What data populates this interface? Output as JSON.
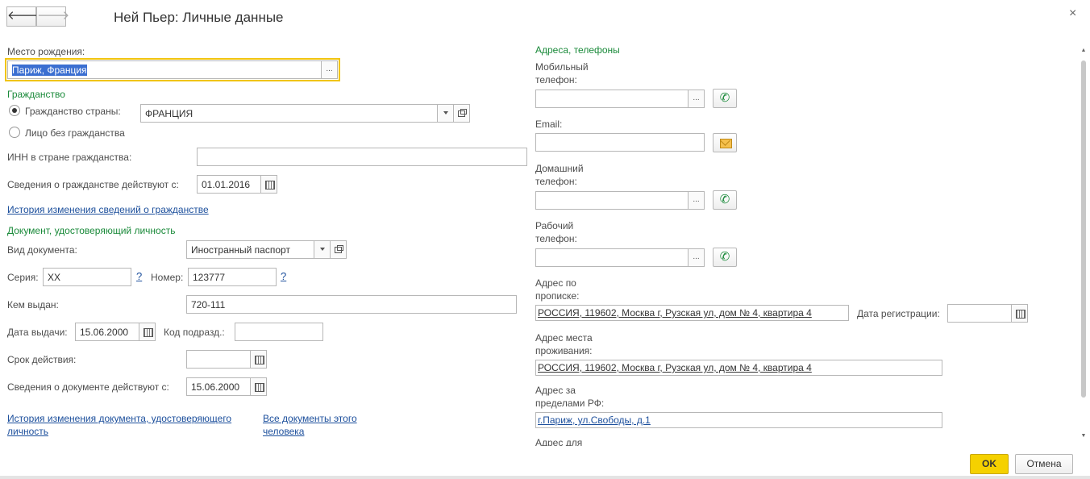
{
  "window": {
    "title": "Ней Пьер: Личные данные",
    "back_label": "🡐",
    "forward_label": "🡒",
    "close_label": "×"
  },
  "left": {
    "birthplace": {
      "label": "Место рождения:",
      "value": "Париж, Франция",
      "button": "..."
    },
    "citizenship": {
      "section": "Гражданство",
      "country_radio_label": "Гражданство страны:",
      "country_value": "ФРАНЦИЯ",
      "stateless_radio_label": "Лицо без гражданства",
      "inn_label": "ИНН в стране гражданства:",
      "inn_value": "",
      "valid_from_label": "Сведения о гражданстве действуют с:",
      "valid_from_value": "01.01.2016",
      "history_link": "История изменения сведений о гражданстве"
    },
    "document": {
      "section": "Документ, удостоверяющий личность",
      "type_label": "Вид документа:",
      "type_value": "Иностранный паспорт",
      "series_label": "Серия:",
      "series_value": "XX",
      "help_mark": "?",
      "number_label": "Номер:",
      "number_value": "123777",
      "issued_by_label": "Кем выдан:",
      "issued_by_value": "720-111",
      "issue_date_label": "Дата выдачи:",
      "issue_date_value": "15.06.2000",
      "division_code_label": "Код подразд.:",
      "division_code_value": "",
      "expiry_label": "Срок действия:",
      "expiry_value": "  .  .",
      "valid_from_label": "Сведения о документе действуют с:",
      "valid_from_value": "15.06.2000",
      "history_link": "История изменения документа, удостоверяющего личность",
      "all_docs_link": "Все документы этого человека"
    }
  },
  "right": {
    "section": "Адреса, телефоны",
    "mobile": {
      "label": "Мобильный телефон:",
      "value": "",
      "button": "..."
    },
    "email": {
      "label": "Email:",
      "value": ""
    },
    "home": {
      "label": "Домашний телефон:",
      "value": "",
      "button": "..."
    },
    "work": {
      "label": "Рабочий телефон:",
      "value": "",
      "button": "..."
    },
    "phone_icon": "✆",
    "registration_address": {
      "label": "Адрес по прописке:",
      "value": "РОССИЯ, 119602, Москва г, Рузская ул, дом № 4, квартира 4"
    },
    "registration_date": {
      "label": "Дата регистрации:",
      "value": "  .  ."
    },
    "residence_address": {
      "label": "Адрес места проживания:",
      "value": "РОССИЯ, 119602, Москва г, Рузская ул, дом № 4, квартира 4"
    },
    "foreign_address": {
      "label": "Адрес за пределами РФ:",
      "value": "г.Париж, ул.Свободы, д.1"
    },
    "next_label": "Адрес для"
  },
  "footer": {
    "ok_label": "OK",
    "cancel_label": "Отмена"
  },
  "colors": {
    "accent": "#f5d100",
    "section": "#1a8a3a",
    "link": "#1c4f9c",
    "focus": "#f1c40f"
  }
}
